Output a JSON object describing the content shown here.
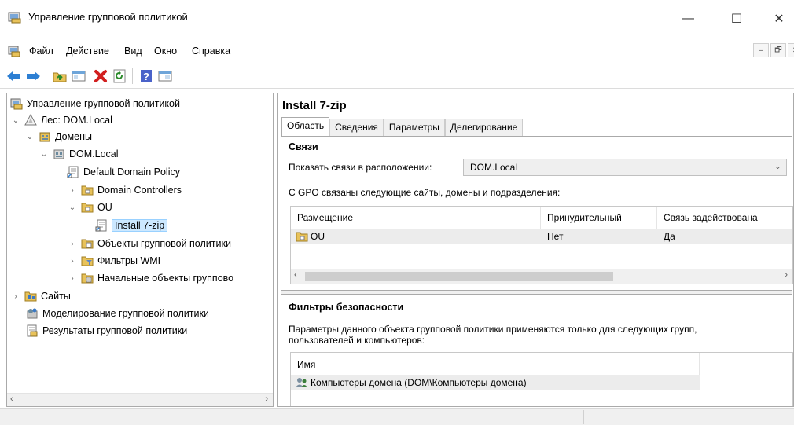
{
  "window": {
    "title": "Управление групповой политикой",
    "controls": {
      "minimize": "—",
      "maximize": "☐",
      "close": "✕"
    }
  },
  "menu": [
    "Файл",
    "Действие",
    "Вид",
    "Окно",
    "Справка"
  ],
  "mdi_controls": [
    "–",
    "🗗",
    "✕"
  ],
  "toolbar": [
    "back-arrow-icon",
    "forward-arrow-icon",
    "folder-up-icon",
    "show-hide-pane-icon",
    "delete-icon",
    "refresh-icon",
    "help-icon",
    "properties-icon"
  ],
  "tree": {
    "root": "Управление групповой политикой",
    "forest": "Лес: DOM.Local",
    "domains": "Домены",
    "domain": "DOM.Local",
    "default_policy": "Default Domain Policy",
    "domain_controllers": "Domain Controllers",
    "ou": "OU",
    "install_gpo": "Install 7-zip",
    "gpo_objects": "Объекты групповой политики",
    "wmi_filters": "Фильтры WMI",
    "starter_gpos": "Начальные объекты группово",
    "sites": "Сайты",
    "modeling": "Моделирование групповой политики",
    "results": "Результаты групповой политики"
  },
  "details": {
    "title": "Install 7-zip",
    "tabs": [
      "Область",
      "Сведения",
      "Параметры",
      "Делегирование"
    ],
    "active_tab": "Область",
    "links_heading": "Связи",
    "show_links_label": "Показать связи в расположении:",
    "location_value": "DOM.Local",
    "linked_label": "С GPO связаны следующие сайты, домены и подразделения:",
    "links_columns": [
      "Размещение",
      "Принудительный",
      "Связь задействована"
    ],
    "links_rows": [
      {
        "location": "OU",
        "enforced": "Нет",
        "enabled": "Да"
      }
    ],
    "filter_heading": "Фильтры безопасности",
    "filter_desc": "Параметры данного объекта групповой политики применяются только для следующих групп, пользователей и компьютеров:",
    "filter_column": "Имя",
    "filter_rows": [
      "Компьютеры домена (DOM\\Компьютеры домена)"
    ]
  },
  "colors": {
    "selection": "#cce8ff",
    "row_bg": "#ececec",
    "folder": "#e8c25a"
  }
}
